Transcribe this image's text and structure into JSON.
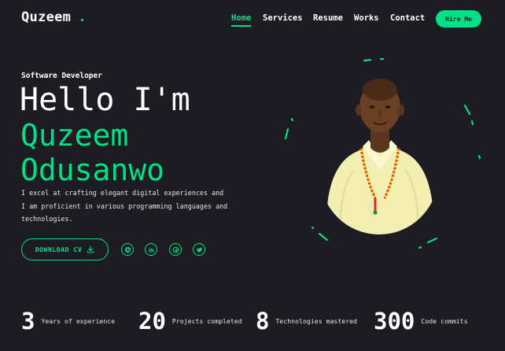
{
  "header": {
    "logo_text": "Quzeem",
    "logo_dot": ".",
    "nav": [
      {
        "label": "Home",
        "active": true
      },
      {
        "label": "Services",
        "active": false
      },
      {
        "label": "Resume",
        "active": false
      },
      {
        "label": "Works",
        "active": false
      },
      {
        "label": "Contact",
        "active": false
      }
    ],
    "hire_label": "Hire Me"
  },
  "hero": {
    "subtitle": "Software Developer",
    "greeting": "Hello I'm",
    "first_name": "Quzeem",
    "last_name": "Odusanwo",
    "description_lines": [
      "I excel at crafting elegant digital experiences and",
      "I am proficient in various programming languages and",
      "technologies."
    ],
    "download_label": "DOWNLOAD CV",
    "download_icon": "download-icon",
    "socials": [
      "github-icon",
      "linkedin-icon",
      "facebook-icon",
      "twitter-icon"
    ]
  },
  "stats": [
    {
      "number": "3",
      "label": "Years of experience"
    },
    {
      "number": "20",
      "label": "Projects completed"
    },
    {
      "number": "8",
      "label": "Technologies mastered"
    },
    {
      "number": "300",
      "label": "Code commits"
    }
  ],
  "colors": {
    "accent": "#00e187",
    "background": "#1c1c22",
    "text": "#ffffff"
  }
}
